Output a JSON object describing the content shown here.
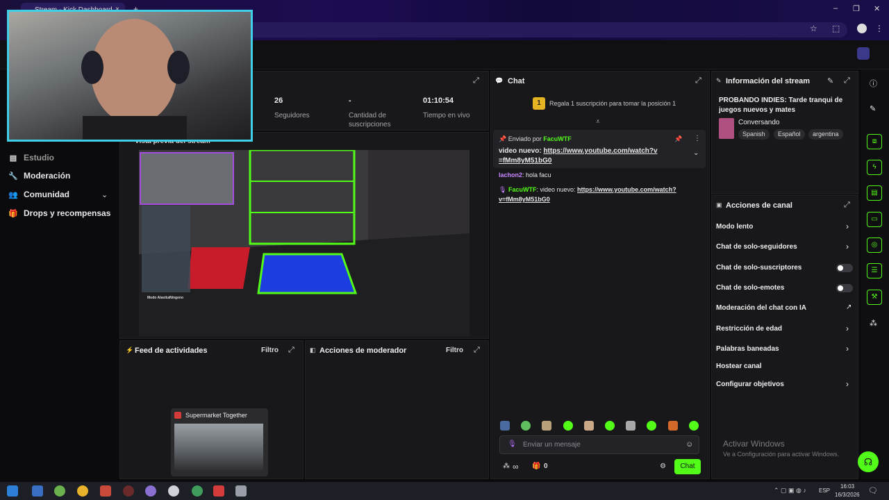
{
  "browser": {
    "tab_title": "Stream - Kick Dashboard",
    "tab_close": "×",
    "new_tab": "+",
    "win_min": "–",
    "win_max": "❐",
    "win_close": "✕"
  },
  "stats": [
    {
      "value": "26",
      "label": "Seguidores"
    },
    {
      "value": "-",
      "label": "Cantidad de suscripciones"
    },
    {
      "value": "01:10:54",
      "label": "Tiempo en vivo"
    }
  ],
  "sidebar": {
    "partial_top": "Estudio",
    "items": [
      {
        "label": "Moderación",
        "icon": "wrench-icon"
      },
      {
        "label": "Comunidad",
        "icon": "community-icon"
      },
      {
        "label": "Drops y recompensas",
        "icon": "gift-icon"
      }
    ]
  },
  "preview": {
    "title": "Vista previa del stream",
    "overlay_head_1": "Modo Alasitur",
    "overlay_head_2": "Ningeno"
  },
  "chat": {
    "title": "Chat",
    "sub_goal_rank": "1",
    "sub_goal_text": "Regala 1 suscripción para tomar la posición 1",
    "pinned_label": "Enviado por",
    "pinned_user": "FacuWTF",
    "pinned_text": "video nuevo: ",
    "pinned_link": "https://www.youtube.com/watch?v=fMm8yM51bG0",
    "messages": [
      {
        "user": "lachon2",
        "text": "hola facu"
      },
      {
        "user": "FacuWTF",
        "text": "video nuevo: ",
        "link": "https://www.youtube.com/watch?v=fMm8yM51bG0"
      }
    ],
    "input_placeholder": "Enviar un mensaje",
    "infinite": "∞",
    "gift_count": "0",
    "send_label": "Chat"
  },
  "activity": {
    "title": "Feed de actividades",
    "filter": "Filtro"
  },
  "mod_actions": {
    "title": "Acciones de moderador",
    "filter": "Filtro"
  },
  "taskbar_preview": {
    "title": "Supermarket Together"
  },
  "stream_info": {
    "title": "Información del stream",
    "stream_title": "PROBANDO INDIES: Tarde tranqui de juegos nuevos y mates ",
    "category": "Conversando",
    "tags": [
      "Spanish",
      "Español",
      "argentina"
    ]
  },
  "channel_actions": {
    "title": "Acciones de canal",
    "items": [
      {
        "label": "Modo lento",
        "control": "chevron"
      },
      {
        "label": "Chat de solo-seguidores",
        "control": "chevron"
      },
      {
        "label": "Chat de solo-suscriptores",
        "control": "toggle"
      },
      {
        "label": "Chat de solo-emotes",
        "control": "toggle"
      },
      {
        "label": "Moderación del chat con IA",
        "control": "external"
      },
      {
        "label": "Restricción de edad",
        "control": "chevron"
      },
      {
        "label": "Palabras baneadas",
        "control": "chevron"
      },
      {
        "label": "Hostear canal",
        "control": "none"
      },
      {
        "label": "Configurar objetivos",
        "control": "chevron"
      }
    ]
  },
  "watermark": {
    "line1": "Activar Windows",
    "line2": "Ve a Configuración para activar Windows."
  },
  "taskbar": {
    "lang": "ESP",
    "time": "16:03",
    "date": "16/3/2026"
  },
  "colors": {
    "accent": "#53fc18",
    "panel": "#18181b",
    "background": "#0b0b0d",
    "cam_border": "#3fd0e8"
  }
}
